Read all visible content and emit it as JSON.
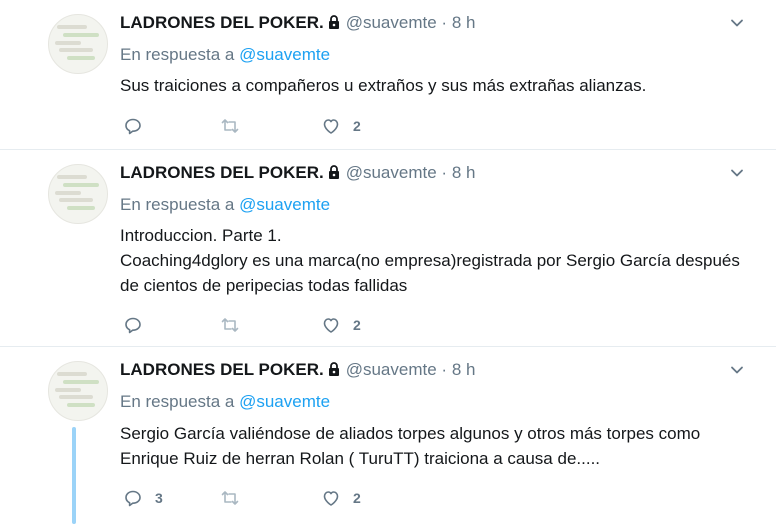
{
  "tweets": [
    {
      "name": "LADRONES DEL POKER.",
      "handle": "@suavemte",
      "dot": "·",
      "time": "8 h",
      "reply_prefix": "En respuesta a",
      "reply_handle": "@suavemte",
      "lines": [
        "Sus traiciones a compañeros u extraños y sus más extrañas alianzas."
      ],
      "reply_count": "",
      "retweet_count": "",
      "like_count": "2"
    },
    {
      "name": "LADRONES DEL POKER.",
      "handle": "@suavemte",
      "dot": "·",
      "time": "8 h",
      "reply_prefix": "En respuesta a",
      "reply_handle": "@suavemte",
      "lines": [
        "Introduccion. Parte 1.",
        "Coaching4dglory es una marca(no empresa)registrada por Sergio García después",
        "de cientos de peripecias todas fallidas"
      ],
      "reply_count": "",
      "retweet_count": "",
      "like_count": "2"
    },
    {
      "name": "LADRONES DEL POKER.",
      "handle": "@suavemte",
      "dot": "·",
      "time": "8 h",
      "reply_prefix": "En respuesta a",
      "reply_handle": "@suavemte",
      "lines": [
        "Sergio García valiéndose de aliados torpes algunos y otros más torpes como",
        "Enrique Ruiz de herran Rolan ( TuruTT) traiciona a causa de....."
      ],
      "reply_count": "3",
      "retweet_count": "",
      "like_count": "2"
    }
  ],
  "icons": {
    "lock": "lock-icon",
    "more": "chevron-down-icon",
    "reply": "reply-icon",
    "retweet": "retweet-icon",
    "like": "heart-icon"
  },
  "colors": {
    "text": "#14171a",
    "muted": "#657786",
    "link": "#1da1f2",
    "thread_line": "#9bd3f8",
    "divider": "#e6ecf0"
  }
}
